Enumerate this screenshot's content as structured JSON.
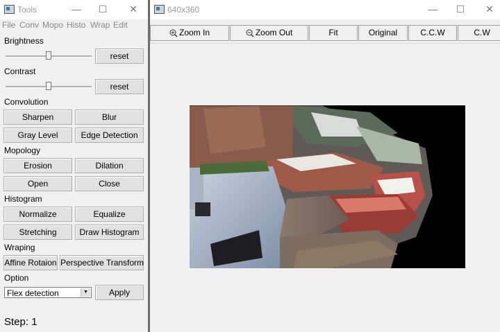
{
  "tools_window": {
    "title": "Tools",
    "menu": [
      "File",
      "Conv",
      "Mopo",
      "Histo",
      "Wrap",
      "Edit"
    ],
    "brightness": {
      "label": "Brightness",
      "reset": "reset",
      "level": 0.5
    },
    "contrast": {
      "label": "Contrast",
      "reset": "reset",
      "level": 0.5
    },
    "convolution": {
      "label": "Convolution",
      "sharpen": "Sharpen",
      "blur": "Blur",
      "gray": "Gray Level",
      "edge": "Edge Detection"
    },
    "mopology": {
      "label": "Mopology",
      "erosion": "Erosion",
      "dilation": "Dilation",
      "open": "Open",
      "close": "Close"
    },
    "histogram": {
      "label": "Histogram",
      "normalize": "Normalize",
      "equalize": "Equalize",
      "stretching": "Stretching",
      "draw": "Draw Histogram"
    },
    "wraping": {
      "label": "Wraping",
      "affine": "Affine Rotaion",
      "perspective": "Perspective Transform"
    },
    "option": {
      "label": "Option",
      "selected": "Flex detection",
      "apply": "Apply"
    },
    "step": "Step: 1"
  },
  "image_window": {
    "title": "640x360",
    "toolbar": {
      "zoom_in": "Zoom In",
      "zoom_out": "Zoom Out",
      "fit": "Fit",
      "original": "Original",
      "ccw": "C.C.W",
      "cw": "C.W"
    }
  }
}
